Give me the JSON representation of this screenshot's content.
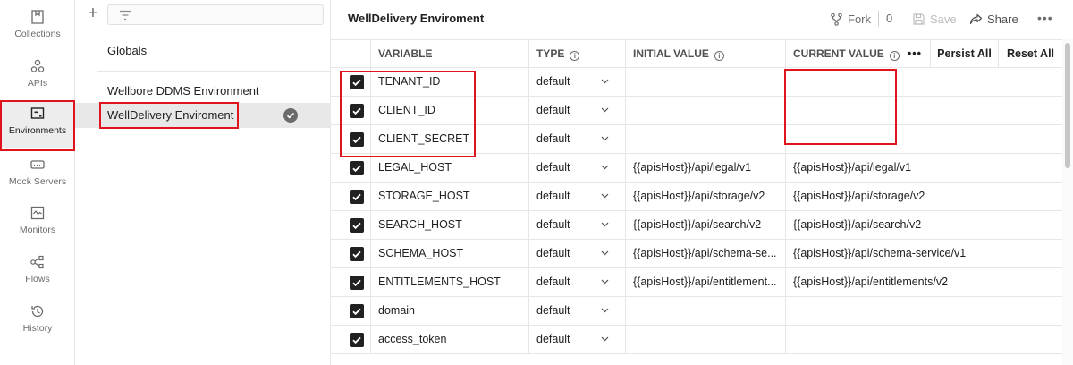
{
  "rail": {
    "items": [
      {
        "label": "Collections",
        "icon": "collections-icon"
      },
      {
        "label": "APIs",
        "icon": "apis-icon"
      },
      {
        "label": "Environments",
        "icon": "environments-icon"
      },
      {
        "label": "Mock Servers",
        "icon": "mock-servers-icon"
      },
      {
        "label": "Monitors",
        "icon": "monitors-icon"
      },
      {
        "label": "Flows",
        "icon": "flows-icon"
      },
      {
        "label": "History",
        "icon": "history-icon"
      }
    ]
  },
  "envpanel": {
    "globals": "Globals",
    "environments": [
      {
        "name": "Wellbore DDMS Environment"
      },
      {
        "name": "WellDelivery Enviroment"
      }
    ]
  },
  "header": {
    "title": "WellDelivery Enviroment",
    "fork_label": "Fork",
    "fork_count": "0",
    "save_label": "Save",
    "share_label": "Share",
    "more_label": "•••"
  },
  "table": {
    "columns": {
      "variable": "VARIABLE",
      "type": "TYPE",
      "initial": "INITIAL VALUE",
      "current": "CURRENT VALUE",
      "more": "•••",
      "persist_all": "Persist All",
      "reset_all": "Reset All"
    },
    "rows": [
      {
        "variable": "TENANT_ID",
        "type": "default",
        "initial": "",
        "current": ""
      },
      {
        "variable": "CLIENT_ID",
        "type": "default",
        "initial": "",
        "current": ""
      },
      {
        "variable": "CLIENT_SECRET",
        "type": "default",
        "initial": "",
        "current": ""
      },
      {
        "variable": "LEGAL_HOST",
        "type": "default",
        "initial": "{{apisHost}}/api/legal/v1",
        "current": "{{apisHost}}/api/legal/v1"
      },
      {
        "variable": "STORAGE_HOST",
        "type": "default",
        "initial": "{{apisHost}}/api/storage/v2",
        "current": "{{apisHost}}/api/storage/v2"
      },
      {
        "variable": "SEARCH_HOST",
        "type": "default",
        "initial": "{{apisHost}}/api/search/v2",
        "current": "{{apisHost}}/api/search/v2"
      },
      {
        "variable": "SCHEMA_HOST",
        "type": "default",
        "initial": "{{apisHost}}/api/schema-se...",
        "current": "{{apisHost}}/api/schema-service/v1"
      },
      {
        "variable": "ENTITLEMENTS_HOST",
        "type": "default",
        "initial": "{{apisHost}}/api/entitlement...",
        "current": "{{apisHost}}/api/entitlements/v2"
      },
      {
        "variable": "domain",
        "type": "default",
        "initial": "",
        "current": ""
      },
      {
        "variable": "access_token",
        "type": "default",
        "initial": "",
        "current": ""
      }
    ]
  },
  "colors": {
    "highlight": "#e0141d",
    "checkbox": "#212121",
    "accent_bg": "#ededed"
  }
}
